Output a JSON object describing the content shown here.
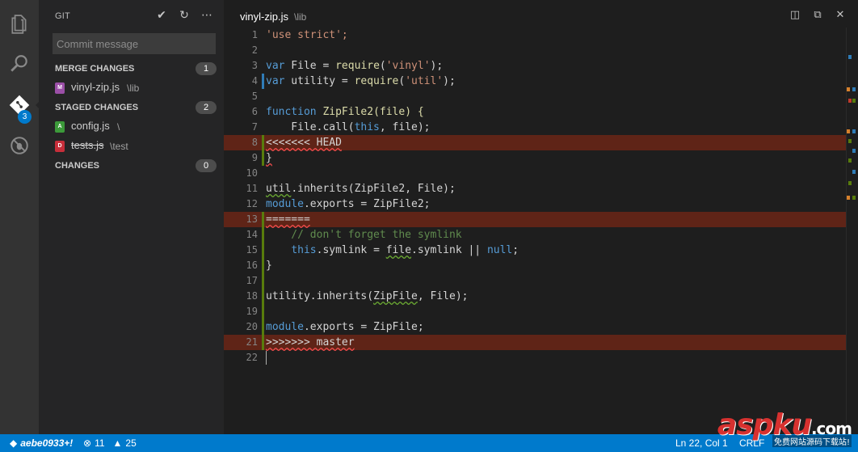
{
  "colors": {
    "activity_bar": "#333333",
    "sidebar": "#252526",
    "editor": "#1e1e1e",
    "status_bar": "#007acc",
    "conflict_bg": "#5f2417",
    "badge": "#007acc"
  },
  "activity": {
    "scm_badge": "3",
    "icons": [
      "files-icon",
      "search-icon",
      "git-icon",
      "debug-icon"
    ]
  },
  "sidebar": {
    "title": "GIT",
    "commit_placeholder": "Commit message",
    "sections": [
      {
        "label": "MERGE CHANGES",
        "count": "1",
        "files": [
          {
            "letter": "M",
            "name": "vinyl-zip.js",
            "path": "\\lib",
            "color": "#9b4fa7"
          }
        ]
      },
      {
        "label": "STAGED CHANGES",
        "count": "2",
        "files": [
          {
            "letter": "A",
            "name": "config.js",
            "path": "\\",
            "color": "#3c9a3a"
          },
          {
            "letter": "D",
            "name": "tests.js",
            "path": "\\test",
            "color": "#c72e3a"
          }
        ]
      },
      {
        "label": "CHANGES",
        "count": "0",
        "files": []
      }
    ]
  },
  "editor": {
    "tab_title": "vinyl-zip.js",
    "tab_path": "\\lib",
    "lines": [
      {
        "n": "1"
      },
      {
        "n": "2"
      },
      {
        "n": "3"
      },
      {
        "n": "4"
      },
      {
        "n": "5"
      },
      {
        "n": "6"
      },
      {
        "n": "7"
      },
      {
        "n": "8"
      },
      {
        "n": "9"
      },
      {
        "n": "10"
      },
      {
        "n": "11"
      },
      {
        "n": "12"
      },
      {
        "n": "13"
      },
      {
        "n": "14"
      },
      {
        "n": "15"
      },
      {
        "n": "16"
      },
      {
        "n": "17"
      },
      {
        "n": "18"
      },
      {
        "n": "19"
      },
      {
        "n": "20"
      },
      {
        "n": "21"
      },
      {
        "n": "22"
      }
    ],
    "code": {
      "l1": "'use strict';",
      "l3_kw": "var",
      "l3_rest": " File = ",
      "l3_fn": "require",
      "l3_str": "'vinyl'",
      "l3_end": ");",
      "l4_kw": "var",
      "l4_rest": " utility = ",
      "l4_fn": "require",
      "l4_str": "'util'",
      "l4_end": ");",
      "l6_kw": "function",
      "l6_rest": " ZipFile2(file) {",
      "l7_a": "    File.call(",
      "l7_kw": "this",
      "l7_b": ", file);",
      "l8": "<<<<<<< HEAD",
      "l9": "}",
      "l11_a": "util",
      "l11_b": ".inherits(ZipFile2, File);",
      "l12_a": "module",
      "l12_b": ".exports = ZipFile2;",
      "l13": "=======",
      "l14": "    // don't forget the symlink",
      "l15_kw": "this",
      "l15_a": ".symlink = ",
      "l15_b": "file",
      "l15_c": ".symlink || ",
      "l15_null": "null",
      "l15_d": ";",
      "l16": "}",
      "l18_a": "utility.inherits(",
      "l18_b": "ZipFile",
      "l18_c": ", File);",
      "l20_a": "module",
      "l20_b": ".exports = ZipFile;",
      "l21": ">>>>>>> master"
    }
  },
  "status": {
    "branch": "aebe0933+!",
    "errors": "11",
    "warnings": "25",
    "position": "Ln 22, Col 1",
    "eol": "CRLF"
  },
  "watermark": {
    "brand": "aspku",
    "tld": ".com",
    "tagline": "免费网站源码下载站!"
  }
}
